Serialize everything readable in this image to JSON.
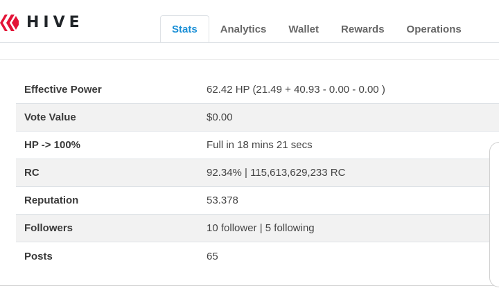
{
  "brand": {
    "name": "HIVE",
    "logo_icon": "hive-logo-icon",
    "logo_color": "#e31337"
  },
  "tabs": [
    {
      "label": "Stats",
      "active": true
    },
    {
      "label": "Analytics",
      "active": false
    },
    {
      "label": "Wallet",
      "active": false
    },
    {
      "label": "Rewards",
      "active": false
    },
    {
      "label": "Operations",
      "active": false
    }
  ],
  "colors": {
    "active_tab": "#1a8fd6",
    "inactive_tab": "#666666",
    "row_stripe": "#f2f2f2"
  },
  "stats": [
    {
      "label": "Effective Power",
      "value": "62.42 HP (21.49 + 40.93 - 0.00 - 0.00 )"
    },
    {
      "label": "Vote Value",
      "value": "$0.00"
    },
    {
      "label": "HP -> 100%",
      "value": "Full in 18 mins 21 secs"
    },
    {
      "label": "RC",
      "value": "92.34% | 115,613,629,233 RC"
    },
    {
      "label": "Reputation",
      "value": "53.378"
    },
    {
      "label": "Followers",
      "value": "10 follower | 5 following"
    },
    {
      "label": "Posts",
      "value": "65"
    }
  ]
}
